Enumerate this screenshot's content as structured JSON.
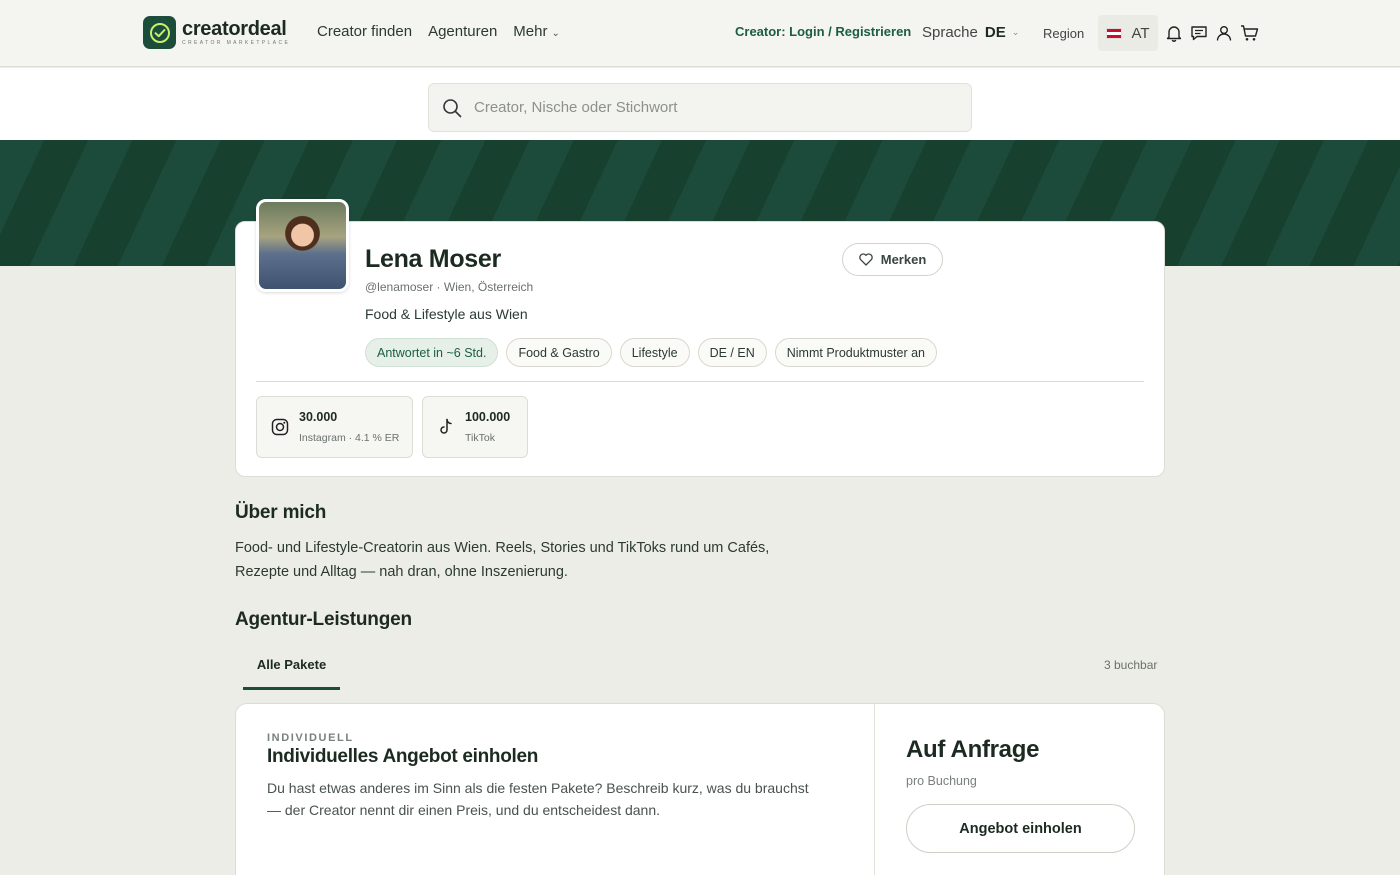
{
  "header": {
    "logo": {
      "name": "creatordeal",
      "tagline": "CREATOR MARKETPLACE",
      "icon": "check-circle-icon"
    },
    "nav": [
      {
        "label": "Creator finden"
      },
      {
        "label": "Agenturen"
      },
      {
        "label": "Mehr"
      }
    ],
    "creator_login": "Creator: Login / Registrieren",
    "language_label": "Sprache",
    "language_value": "DE",
    "region_label": "Region",
    "region_value": "AT",
    "icons": [
      "bell-icon",
      "chat-icon",
      "user-icon",
      "cart-icon"
    ]
  },
  "search": {
    "placeholder": "Creator, Nische oder Stichwort"
  },
  "profile": {
    "name": "Lena Moser",
    "handle_location": "@lenamoser · Wien, Österreich",
    "bio_short": "Food & Lifestyle aus Wien",
    "save_label": "Merken",
    "tags": [
      {
        "label": "Antwortet in ~6 Std."
      },
      {
        "label": "Food & Gastro"
      },
      {
        "label": "Lifestyle"
      },
      {
        "label": "DE / EN"
      },
      {
        "label": "Nimmt Produktmuster an"
      }
    ],
    "stats": [
      {
        "count": "30.000",
        "detail": "Instagram · 4.1 % ER",
        "icon": "instagram-icon"
      },
      {
        "count": "100.000",
        "detail": "TikTok",
        "icon": "tiktok-icon"
      }
    ]
  },
  "about": {
    "title": "Über mich",
    "line1": "Food- und Lifestyle-Creatorin aus Wien. Reels, Stories und TikToks rund um Cafés,",
    "line2": "Rezepte und Alltag — nah dran, ohne Inszenierung."
  },
  "services": {
    "title": "Agentur-Leistungen",
    "tab": "Alle Pakete",
    "count": "3 buchbar"
  },
  "package": {
    "kicker": "INDIVIDUELL",
    "title": "Individuelles Angebot einholen",
    "desc_line1": "Du hast etwas anderes im Sinn als die festen Pakete? Beschreib kurz, was du brauchst",
    "desc_line2": "— der Creator nennt dir einen Preis, und du entscheidest dann.",
    "price": "Auf Anfrage",
    "price_unit": "pro Buchung",
    "cta": "Angebot einholen"
  },
  "colors": {
    "brand": "#1b4d3a",
    "accent": "#1b5e40",
    "background": "#edede7"
  }
}
